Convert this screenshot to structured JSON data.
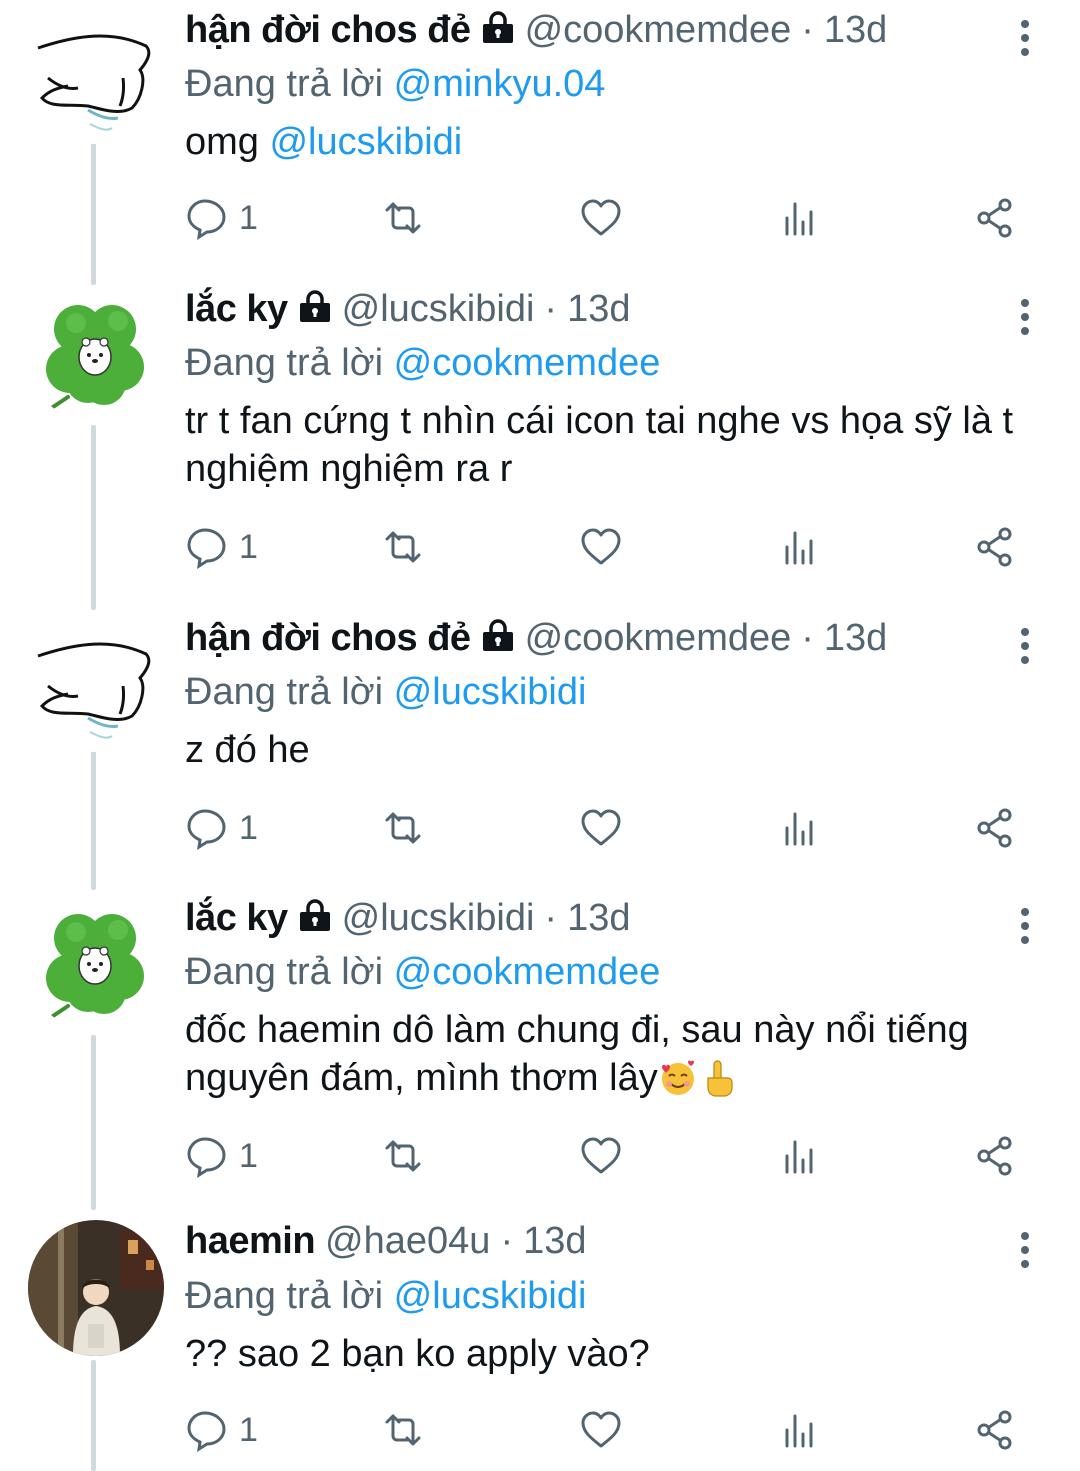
{
  "tweets": [
    {
      "name": "hận đời chos đẻ",
      "handle": "@cookmemdee",
      "time": "13d",
      "replying_label": "Đang trả lời ",
      "replying_to": "@minkyu.04",
      "text_before": "omg ",
      "text_mention": "@lucskibidi",
      "text_after": "",
      "reply_count": "1",
      "avatar": "sketch-avatar-icon"
    },
    {
      "name": "lắc ky",
      "handle": "@lucskibidi",
      "time": "13d",
      "replying_label": "Đang trả lời ",
      "replying_to": "@cookmemdee",
      "text": "tr t fan cứng t nhìn cái icon tai nghe vs họa sỹ là t nghiệm nghiệm ra r",
      "reply_count": "1",
      "avatar": "clover-avatar-icon"
    },
    {
      "name": "hận đời chos đẻ",
      "handle": "@cookmemdee",
      "time": "13d",
      "replying_label": "Đang trả lời ",
      "replying_to": "@lucskibidi",
      "text": "z đó he",
      "reply_count": "1",
      "avatar": "sketch-avatar-icon"
    },
    {
      "name": "lắc ky",
      "handle": "@lucskibidi",
      "time": "13d",
      "replying_label": "Đang trả lời ",
      "replying_to": "@cookmemdee",
      "text": "đốc haemin dô làm chung đi, sau này nổi tiếng nguyên đám, mình thơm lây",
      "emojis": [
        "smiling-face-with-hearts-icon",
        "index-pointing-up-icon"
      ],
      "reply_count": "1",
      "avatar": "clover-avatar-icon"
    },
    {
      "name": "haemin",
      "handle": "@hae04u",
      "time": "13d",
      "replying_label": "Đang trả lời ",
      "replying_to": "@lucskibidi",
      "text": "?? sao 2 bạn ko apply vào?",
      "reply_count": "1",
      "avatar": "photo-avatar-icon"
    }
  ],
  "separator": "·",
  "colors": {
    "text": "#0f1419",
    "secondary": "#536471",
    "link": "#1d9bf0",
    "thread_line": "#cfd9de",
    "clover": "#4caf3a"
  },
  "icons": {
    "lock": "lock-icon",
    "more": "more-options-icon",
    "reply": "reply-icon",
    "retweet": "retweet-icon",
    "like": "like-icon",
    "views": "views-icon",
    "share": "share-icon"
  }
}
